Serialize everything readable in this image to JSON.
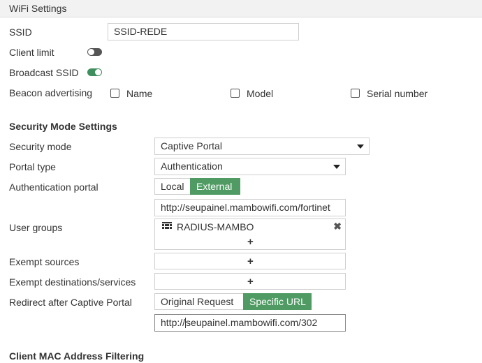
{
  "header": {
    "title": "WiFi Settings"
  },
  "ssid": {
    "label": "SSID",
    "value": "SSID-REDE"
  },
  "client_limit": {
    "label": "Client limit",
    "enabled": false
  },
  "broadcast_ssid": {
    "label": "Broadcast SSID",
    "enabled": true
  },
  "beacon": {
    "label": "Beacon advertising",
    "options": [
      {
        "label": "Name",
        "checked": false
      },
      {
        "label": "Model",
        "checked": false
      },
      {
        "label": "Serial number",
        "checked": false
      }
    ]
  },
  "security": {
    "title": "Security Mode Settings",
    "mode_label": "Security mode",
    "mode_value": "Captive Portal",
    "portal_type_label": "Portal type",
    "portal_type_value": "Authentication",
    "auth_portal_label": "Authentication portal",
    "auth_portal_options": [
      "Local",
      "External"
    ],
    "auth_portal_selected": "External",
    "auth_portal_url": "http://seupainel.mambowifi.com/fortinet",
    "user_groups_label": "User groups",
    "user_groups": [
      "RADIUS-MAMBO"
    ],
    "add_symbol": "+",
    "remove_symbol": "✖",
    "exempt_sources_label": "Exempt sources",
    "exempt_dest_label": "Exempt destinations/services",
    "redirect_label": "Redirect after Captive Portal",
    "redirect_options": [
      "Original Request",
      "Specific URL"
    ],
    "redirect_selected": "Specific URL",
    "redirect_url_prefix": "http://",
    "redirect_url_suffix": "seupainel.mambowifi.com/302"
  },
  "mac_filtering": {
    "title": "Client MAC Address Filtering"
  },
  "colors": {
    "accent_green": "#4f9b63",
    "toggle_on": "#3e8e5e",
    "toggle_off": "#555555"
  }
}
